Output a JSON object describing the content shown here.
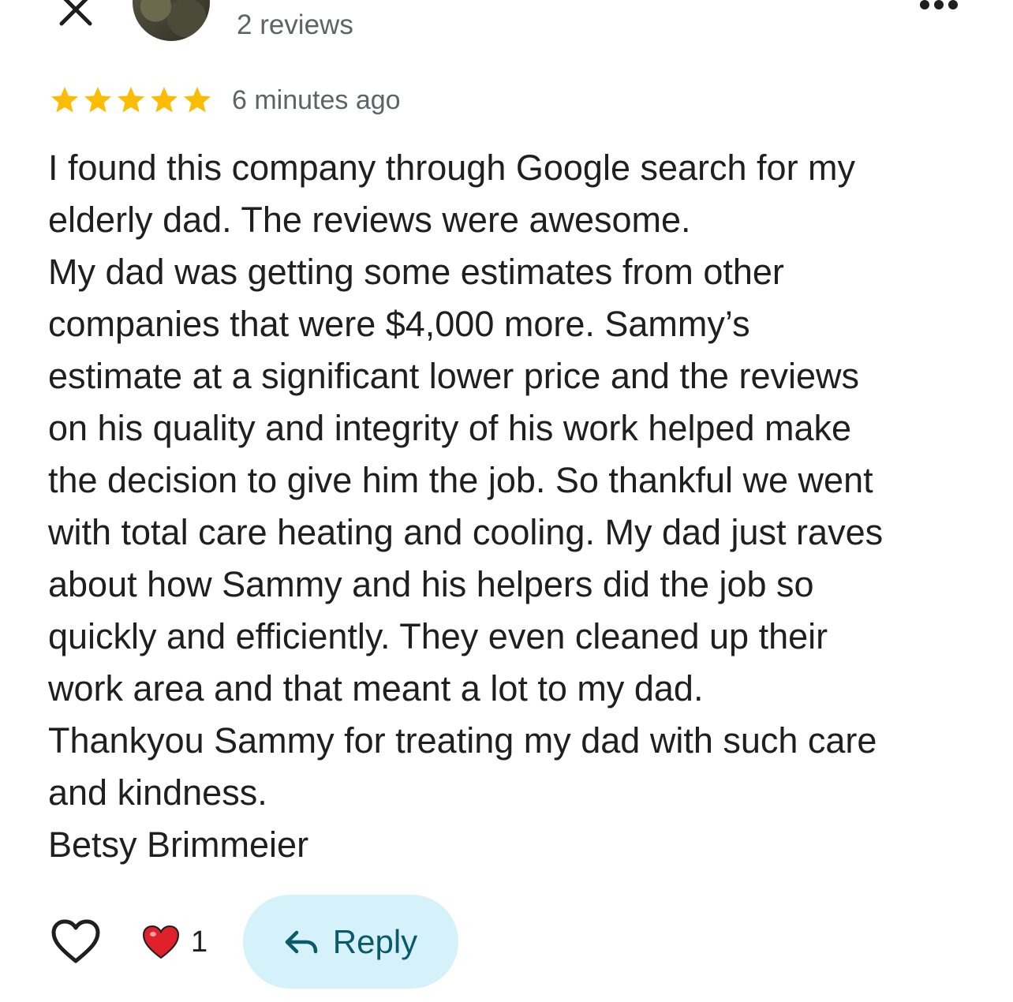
{
  "header": {
    "reviews_count": "2 reviews",
    "icons": {
      "close": "close-icon",
      "avatar": "reviewer-avatar",
      "more": "more-options-icon"
    }
  },
  "review": {
    "rating": 5,
    "rating_max": 5,
    "time_ago": "6 minutes ago",
    "lines": [
      "I found this company through Google search for my",
      "elderly dad. The reviews were awesome.",
      "My dad was getting some estimates from other",
      "companies that were $4,000 more. Sammy’s",
      "estimate at a significant lower price and the reviews",
      "on his quality and integrity of his work helped make",
      "the decision to give him the job. So thankful we went",
      "with total care heating and cooling. My dad just raves",
      "about how Sammy and his helpers did the job so",
      "quickly and efficiently. They even cleaned up their",
      "work area and that meant a lot to my dad.",
      "Thankyou Sammy for treating my dad with such care",
      "and kindness.",
      "Betsy Brimmeier"
    ]
  },
  "actions": {
    "reaction_count": "1",
    "reply_label": "Reply",
    "icons": {
      "like": "heart-outline-icon",
      "reaction": "red-heart-icon",
      "reply": "reply-arrow-icon"
    }
  },
  "colors": {
    "star": "#fbbc04",
    "reply_bg": "#d5f2fb",
    "reply_text": "#0b5a6a",
    "secondary_text": "#5f6368",
    "heart_red": "#e0202a"
  }
}
